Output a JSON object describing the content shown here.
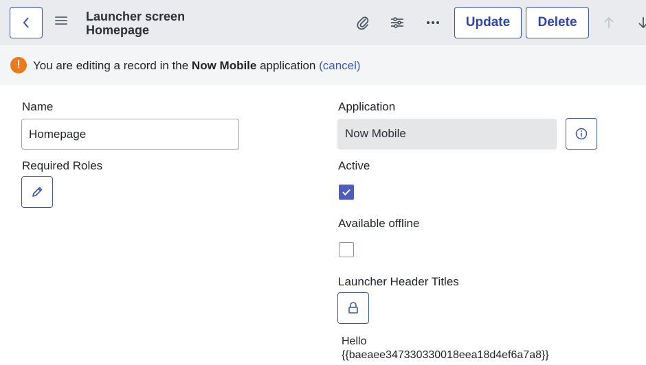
{
  "header": {
    "title_line1": "Launcher screen",
    "title_line2": "Homepage",
    "buttons": {
      "update": "Update",
      "delete": "Delete"
    },
    "icons": [
      "back-chevron-icon",
      "hamburger-icon",
      "paperclip-icon",
      "sliders-icon",
      "more-icon",
      "arrow-up-icon",
      "arrow-down-icon"
    ]
  },
  "notice": {
    "prefix": "You are editing a record in the ",
    "app_name": "Now Mobile",
    "suffix": " application ",
    "cancel": "(cancel)",
    "icon": "warning-icon",
    "icon_glyph": "!",
    "icon_color": "#ea7a1c"
  },
  "form": {
    "name": {
      "label": "Name",
      "value": "Homepage"
    },
    "required_roles": {
      "label": "Required Roles",
      "icon": "pencil-icon"
    },
    "application": {
      "label": "Application",
      "value": "Now Mobile",
      "icon": "info-icon"
    },
    "active": {
      "label": "Active",
      "checked": true
    },
    "available_offline": {
      "label": "Available offline",
      "checked": false
    },
    "launcher_header_titles": {
      "label": "Launcher Header Titles",
      "icon": "lock-icon",
      "value_line1": "Hello",
      "value_line2": "{{baeaee347330330018eea18d4ef6a7a8}}"
    }
  },
  "colors": {
    "accent": "#3b53b5",
    "checkbox": "#4f5bbd",
    "header_bg": "#e9ebee"
  }
}
